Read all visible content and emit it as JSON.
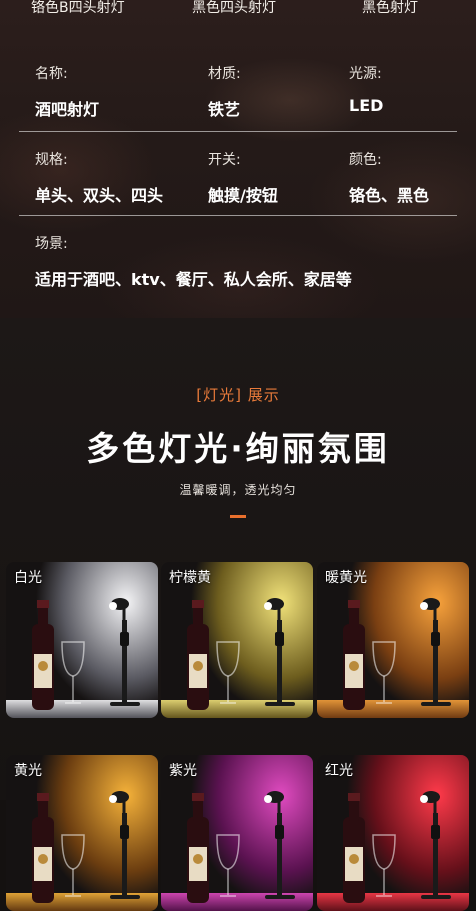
{
  "product_variants": [
    "铬色B四头射灯",
    "黑色四头射灯",
    "黑色射灯"
  ],
  "specs": [
    {
      "label": "名称:",
      "value": "酒吧射灯"
    },
    {
      "label": "材质:",
      "value": "铁艺"
    },
    {
      "label": "光源:",
      "value": "LED"
    },
    {
      "label": "规格:",
      "value": "单头、双头、四头"
    },
    {
      "label": "开关:",
      "value": "触摸/按钮"
    },
    {
      "label": "颜色:",
      "value": "铬色、黑色"
    },
    {
      "label": "场景:",
      "value": "适用于酒吧、ktv、餐厅、私人会所、家居等"
    }
  ],
  "light_section": {
    "subtitle": "[灯光] 展示",
    "title": "多色灯光·绚丽氛围",
    "tagline": "温馨暖调，透光均匀",
    "accent_color": "#e9702d"
  },
  "light_tiles": [
    {
      "name": "白光",
      "color": "#f4f4f6",
      "dark": "#5a5a62"
    },
    {
      "name": "柠檬黄",
      "color": "#f1e27a",
      "dark": "#6d5d1e"
    },
    {
      "name": "暖黄光",
      "color": "#f7a23c",
      "dark": "#7a3f12"
    },
    {
      "name": "黄光",
      "color": "#f5b23a",
      "dark": "#6b3d10"
    },
    {
      "name": "紫光",
      "color": "#e04bc0",
      "dark": "#5a1250"
    },
    {
      "name": "红光",
      "color": "#ff3a4a",
      "dark": "#66101a"
    }
  ],
  "icons": [
    "wine-bottle-icon",
    "wine-glass-icon",
    "spotlight-lamp-icon"
  ]
}
